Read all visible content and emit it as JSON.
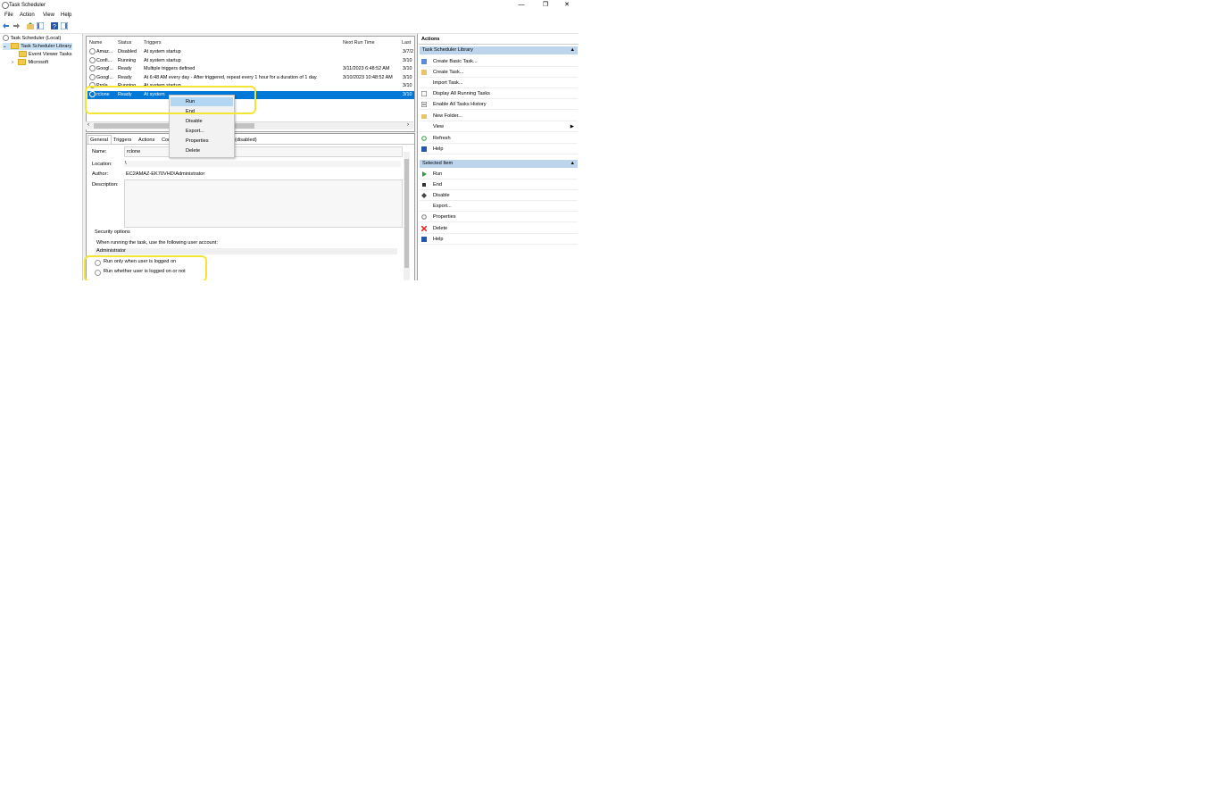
{
  "window": {
    "title": "Task Scheduler",
    "minimize": "—",
    "restore": "❐",
    "close": "✕"
  },
  "menu": [
    "File",
    "Action",
    "View",
    "Help"
  ],
  "tree": {
    "root": "Task Scheduler (Local)",
    "library": "Task Scheduler Library",
    "children": [
      "Event Viewer Tasks",
      "Microsoft"
    ]
  },
  "task_list": {
    "columns": [
      "Name",
      "Status",
      "Triggers",
      "Next Run Time",
      "Last"
    ],
    "rows": [
      {
        "name": "Amaz...",
        "status": "Disabled",
        "triggers": "At system startup",
        "next": "",
        "last": "3/7/2"
      },
      {
        "name": "Confi...",
        "status": "Running",
        "triggers": "At system startup",
        "next": "",
        "last": "3/10"
      },
      {
        "name": "Googl...",
        "status": "Ready",
        "triggers": "Multiple triggers defined",
        "next": "3/11/2023 6:48:52 AM",
        "last": "3/10"
      },
      {
        "name": "Googl...",
        "status": "Ready",
        "triggers": "At 6:48 AM every day - After triggered, repeat every 1 hour for a duration of 1 day.",
        "next": "3/10/2023 10:48:52 AM",
        "last": "3/10"
      },
      {
        "name": "Prola...",
        "status": "Running",
        "triggers": "At system startup",
        "next": "",
        "last": "3/10"
      },
      {
        "name": "rclone",
        "status": "Ready",
        "triggers": "At system",
        "next": "",
        "last": "3/10"
      }
    ]
  },
  "context_menu": [
    "Run",
    "End",
    "Disable",
    "Export...",
    "Properties",
    "Delete"
  ],
  "detail": {
    "tabs": [
      "General",
      "Triggers",
      "Actions",
      "Cor"
    ],
    "tab_suffix": "(disabled)",
    "name_label": "Name:",
    "name_value": "rclone",
    "location_label": "Location:",
    "location_value": "\\",
    "author_label": "Author:",
    "author_value": "EC2AMAZ-EK70VHD\\Administrator",
    "description_label": "Description:",
    "security_title": "Security options",
    "account_prompt": "When running the task, use the following user account:",
    "account_value": "Administrator",
    "radio1": "Run only when user is logged on",
    "radio2": "Run whether user is logged on or not"
  },
  "actions_panel": {
    "header": "Actions",
    "section1": "Task Scheduler Library",
    "items1": [
      "Create Basic Task...",
      "Create Task...",
      "Import Task...",
      "Display All Running Tasks",
      "Enable All Tasks History",
      "New Folder...",
      "View",
      "Refresh",
      "Help"
    ],
    "section2": "Selected Item",
    "items2": [
      "Run",
      "End",
      "Disable",
      "Export...",
      "Properties",
      "Delete",
      "Help"
    ]
  },
  "colors": {
    "selection": "#0078d7",
    "section_header": "#bcd4ec",
    "highlight": "#f5e533"
  }
}
